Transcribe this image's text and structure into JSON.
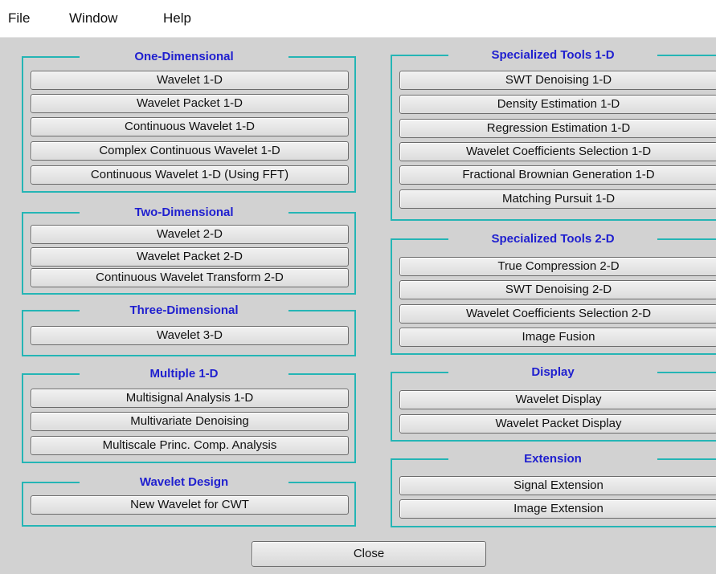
{
  "menubar": {
    "items": [
      "File",
      "Window",
      "Help"
    ]
  },
  "groups": {
    "one_d": {
      "title": "One-Dimensional",
      "buttons": [
        "Wavelet 1-D",
        "Wavelet Packet 1-D",
        "Continuous Wavelet 1-D",
        "Complex Continuous Wavelet 1-D",
        "Continuous Wavelet 1-D (Using FFT)"
      ]
    },
    "two_d": {
      "title": "Two-Dimensional",
      "buttons": [
        "Wavelet 2-D",
        "Wavelet Packet 2-D",
        "Continuous Wavelet Transform 2-D"
      ]
    },
    "three_d": {
      "title": "Three-Dimensional",
      "buttons": [
        "Wavelet 3-D"
      ]
    },
    "multiple_1d": {
      "title": "Multiple 1-D",
      "buttons": [
        "Multisignal Analysis 1-D",
        "Multivariate Denoising",
        "Multiscale Princ. Comp. Analysis"
      ]
    },
    "wavelet_design": {
      "title": "Wavelet Design",
      "buttons": [
        "New Wavelet for CWT"
      ]
    },
    "specialized_1d": {
      "title": "Specialized Tools 1-D",
      "buttons": [
        "SWT Denoising 1-D",
        "Density Estimation 1-D",
        "Regression Estimation 1-D",
        "Wavelet Coefficients Selection 1-D",
        "Fractional Brownian Generation 1-D",
        "Matching Pursuit 1-D"
      ]
    },
    "specialized_2d": {
      "title": "Specialized Tools 2-D",
      "buttons": [
        "True Compression 2-D",
        "SWT Denoising 2-D",
        "Wavelet Coefficients Selection 2-D",
        "Image Fusion"
      ]
    },
    "display": {
      "title": "Display",
      "buttons": [
        "Wavelet Display",
        "Wavelet Packet Display"
      ]
    },
    "extension": {
      "title": "Extension",
      "buttons": [
        "Signal Extension",
        "Image Extension"
      ]
    }
  },
  "footer": {
    "close_label": "Close"
  },
  "colors": {
    "panel_border": "#25b5b5",
    "group_title": "#1f1fcf",
    "background": "#d2d2d2"
  }
}
